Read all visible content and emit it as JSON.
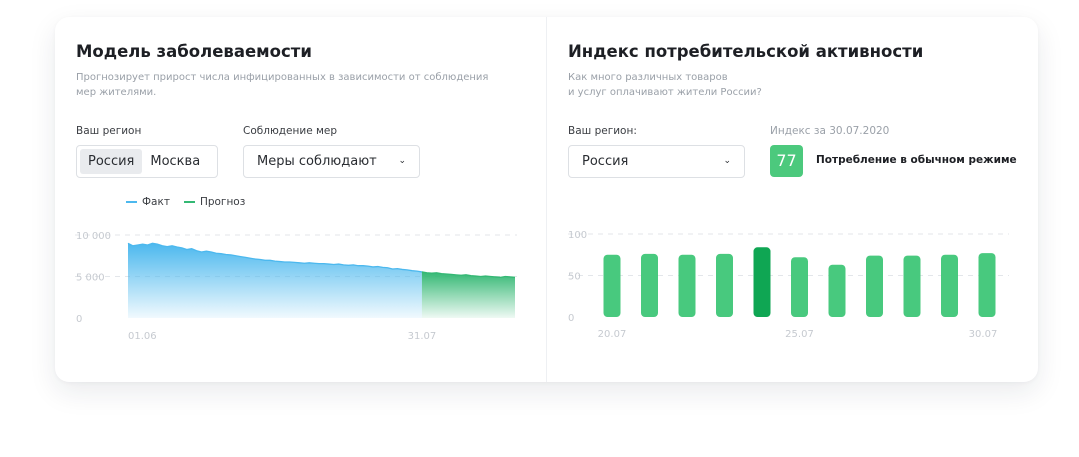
{
  "left": {
    "title": "Модель заболеваемости",
    "subtitle": "Прогнозирует прирост числа инфицированных в зависимости от соблюдения\nмер жителями.",
    "region_label": "Ваш регион",
    "region_options": [
      "Россия",
      "Москва"
    ],
    "region_selected": "Россия",
    "measures_label": "Соблюдение мер",
    "measures_value": "Меры соблюдают",
    "legend": {
      "fact": "Факт",
      "forecast": "Прогноз"
    },
    "colors": {
      "fact": "#4cb8ee",
      "forecast": "#34b874"
    }
  },
  "right": {
    "title": "Индекс потребительской активности",
    "subtitle": "Как много различных товаров\nи услуг оплачивают жители России?",
    "region_label": "Ваш регион:",
    "region_value": "Россия",
    "index_label": "Индекс за 30.07.2020",
    "index_value": "77",
    "index_status": "Потребление в обычном режиме",
    "colors": {
      "bar": "#48c97e",
      "bar_highlight": "#0fa653"
    }
  },
  "chart_data": [
    {
      "type": "area",
      "xlabel": "",
      "ylabel": "",
      "ylim": [
        0,
        10000
      ],
      "y_ticks": [
        "10 000",
        "5 000",
        "0"
      ],
      "x_tick_labels": [
        "01.06",
        "31.07"
      ],
      "grid": true,
      "series": [
        {
          "name": "Факт",
          "x_start": "01.06",
          "values": [
            9000,
            8700,
            8800,
            8900,
            8800,
            9000,
            8900,
            8700,
            8600,
            8700,
            8550,
            8450,
            8250,
            8350,
            8100,
            7950,
            8050,
            7950,
            7800,
            7750,
            7650,
            7600,
            7500,
            7400,
            7300,
            7200,
            7100,
            7050,
            6950,
            6950,
            6850,
            6800,
            6750,
            6750,
            6700,
            6650,
            6600,
            6650,
            6600,
            6550,
            6550,
            6500,
            6450,
            6500,
            6400,
            6350,
            6400,
            6300,
            6300,
            6250,
            6150,
            6200,
            6100,
            6050,
            5900,
            5950,
            5850,
            5800,
            5700,
            5650,
            5550
          ]
        },
        {
          "name": "Прогноз",
          "x_start": "31.07",
          "values": [
            5550,
            5450,
            5400,
            5450,
            5350,
            5300,
            5250,
            5200,
            5150,
            5200,
            5100,
            5050,
            5000,
            5050,
            5000,
            4950,
            4900,
            5000,
            4950,
            4900
          ]
        }
      ]
    },
    {
      "type": "bar",
      "ylim": [
        0,
        100
      ],
      "y_ticks": [
        "100",
        "50",
        "0"
      ],
      "x_tick_labels": [
        "20.07",
        "25.07",
        "30.07"
      ],
      "categories": [
        "20.07",
        "21.07",
        "22.07",
        "23.07",
        "24.07",
        "25.07",
        "26.07",
        "27.07",
        "28.07",
        "29.07",
        "30.07"
      ],
      "values": [
        75,
        76,
        75,
        76,
        84,
        72,
        63,
        74,
        74,
        75,
        77
      ],
      "highlight_index": 4,
      "grid": true
    }
  ]
}
